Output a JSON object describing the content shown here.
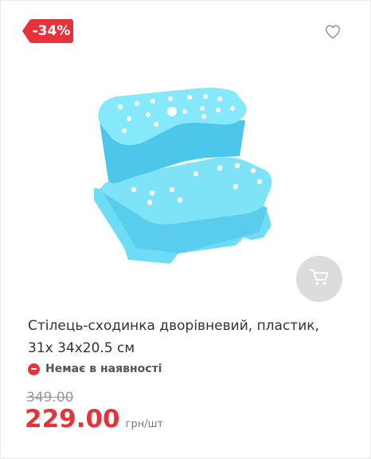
{
  "product": {
    "discount_badge": "-34%",
    "title": "Стілець-сходинка дворівневий, пластик, 31х 34х20.5 см",
    "availability": "Немає в наявності",
    "old_price": "349.00",
    "price": "229.00",
    "unit": "грн/шт"
  },
  "icons": {
    "favorite": "heart-icon",
    "cart": "cart-icon",
    "availability": "minus-circle-icon"
  },
  "colors": {
    "accent": "#e8323a",
    "product": "#5fd3f0"
  }
}
